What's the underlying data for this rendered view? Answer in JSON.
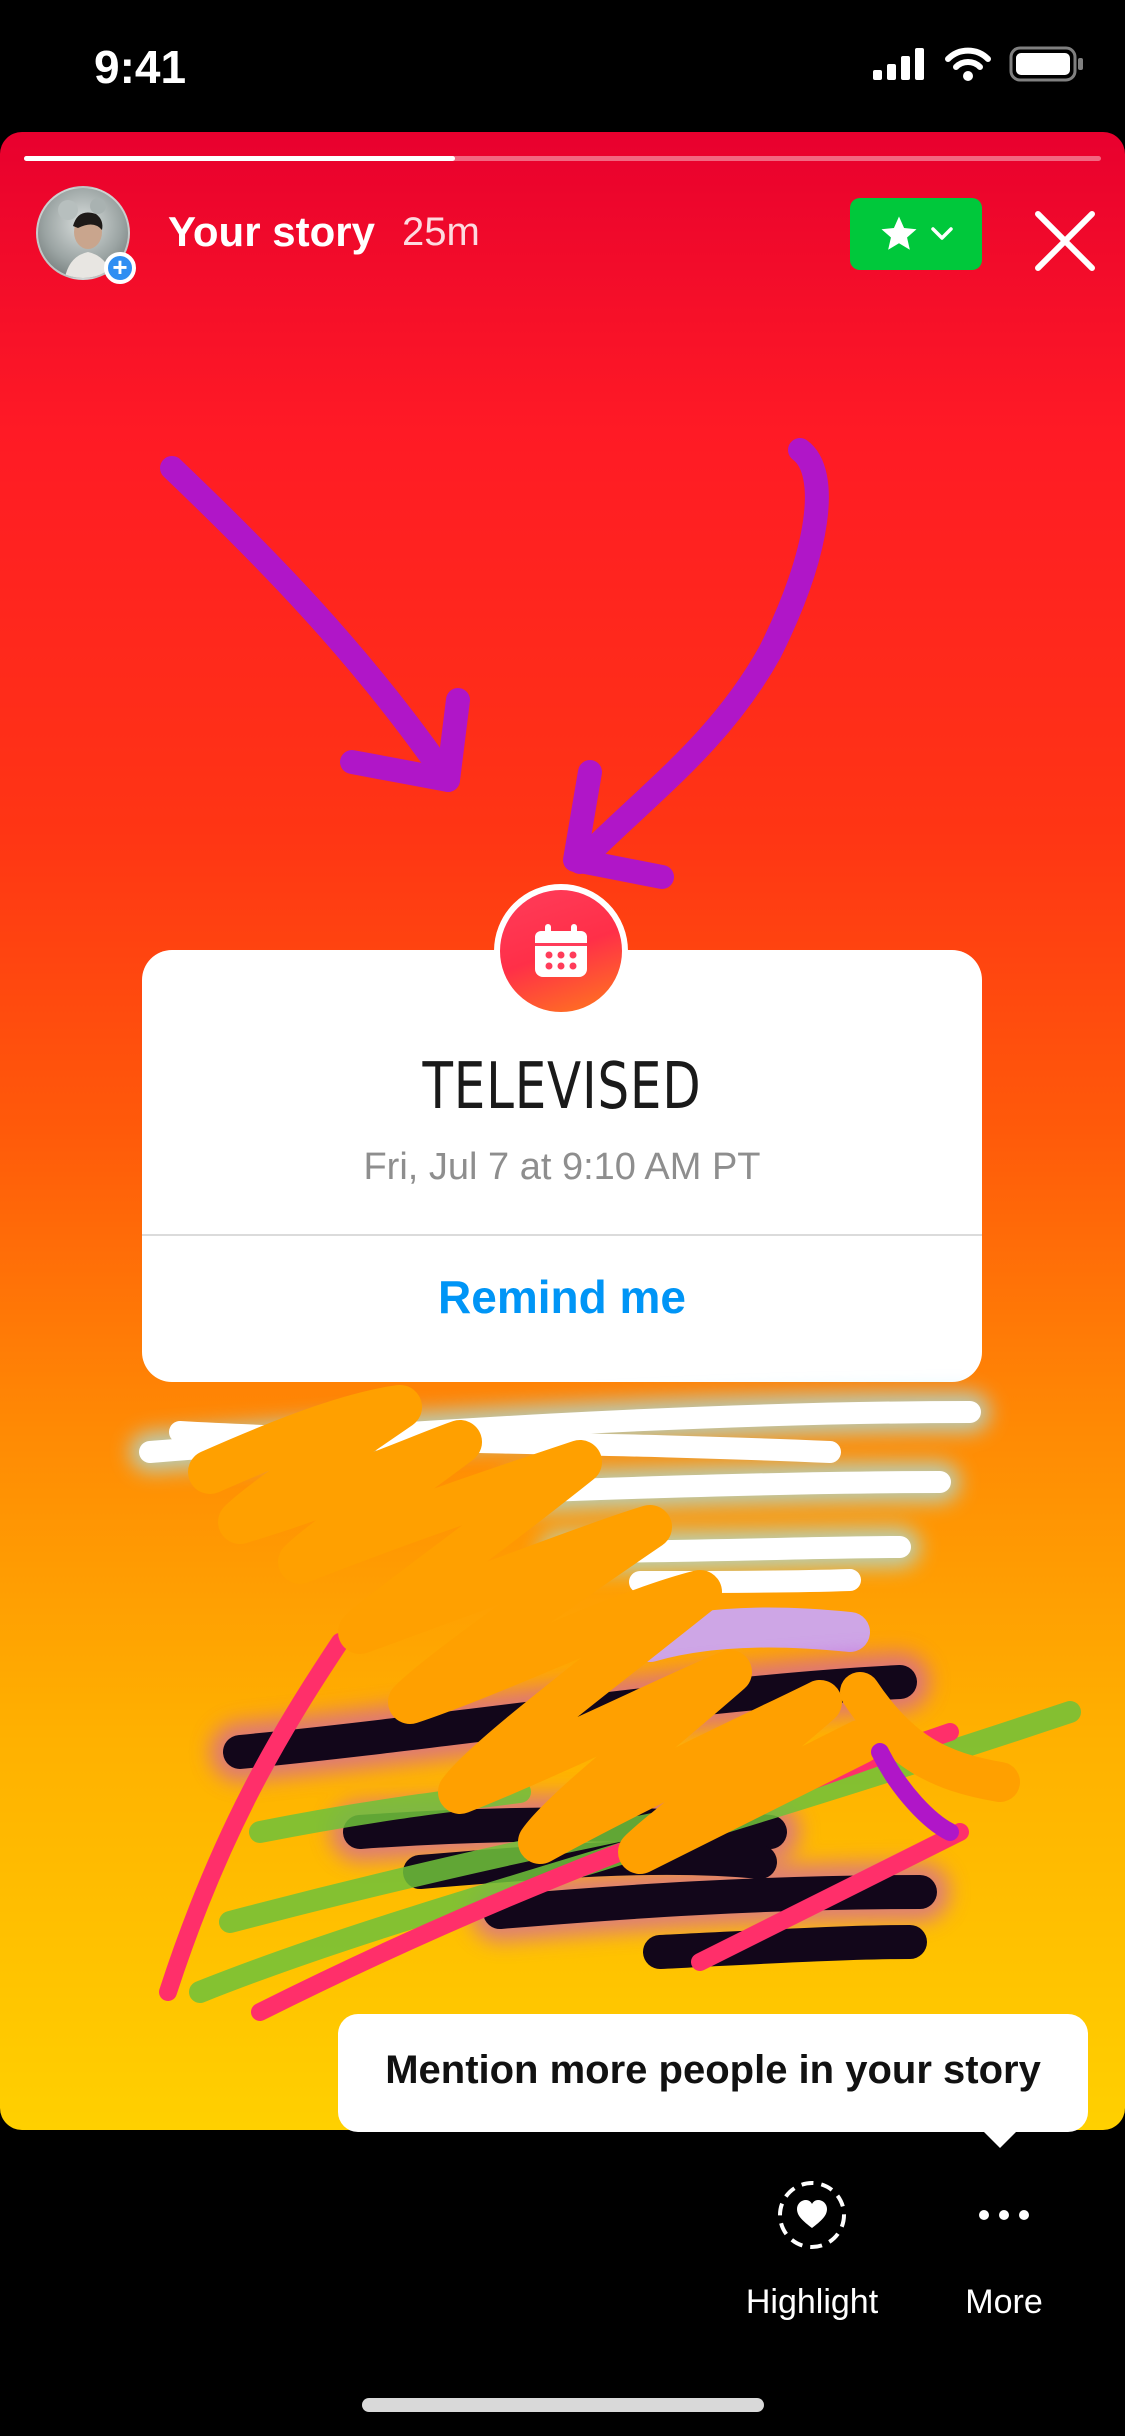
{
  "status_bar": {
    "time": "9:41",
    "signal_icon": "cellular-signal-icon",
    "wifi_icon": "wifi-icon",
    "battery_icon": "battery-icon"
  },
  "story": {
    "progress": 0.4,
    "title": "Your story",
    "time_ago": "25m",
    "close_friends_icon": "star-icon",
    "close_icon": "close-icon",
    "background_top": "#e8002e",
    "background_bottom": "#ffd000"
  },
  "event_sticker": {
    "icon": "calendar-icon",
    "title": "TELEVISED",
    "date": "Fri, Jul 7 at 9:10 AM PT",
    "action": "Remind me",
    "action_color": "#0095f6"
  },
  "tooltip": {
    "text": "Mention more people in your story"
  },
  "bottom_actions": [
    {
      "label": "Highlight",
      "icon": "highlight-heart-icon"
    },
    {
      "label": "More",
      "icon": "more-dots-icon"
    }
  ],
  "colors": {
    "accent_green": "#00c83b",
    "plus_blue": "#2f8ef2",
    "arrow_purple": "#b016c8",
    "scribble_orange": "#ffa000"
  }
}
